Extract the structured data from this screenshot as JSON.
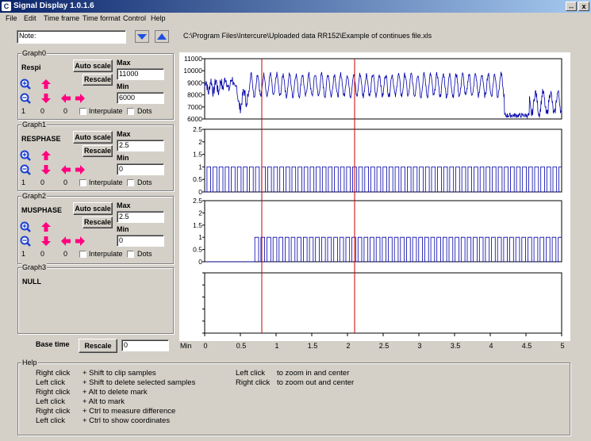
{
  "window": {
    "title": "Signal Display 1.0.1.6",
    "buttons": [
      "↔",
      "x"
    ]
  },
  "menu": [
    "File",
    "Edit",
    "Time frame",
    "Time format",
    "Control",
    "Help"
  ],
  "note": {
    "label": "Note:",
    "value": ""
  },
  "file_path": "C:\\Program Files\\Intercure\\Uploaded data RR152\\Example of continues file.xls",
  "graphs": [
    {
      "group": "Graph0",
      "signal": "Respi",
      "max": "11000",
      "min": "6000",
      "counters": [
        "1",
        "0",
        "0"
      ],
      "interpolate": "Interpulate",
      "dots": "Dots"
    },
    {
      "group": "Graph1",
      "signal": "RESPHASE",
      "max": "2.5",
      "min": "0",
      "counters": [
        "1",
        "0",
        "0"
      ],
      "interpolate": "Interpulate",
      "dots": "Dots"
    },
    {
      "group": "Graph2",
      "signal": "MUSPHASE",
      "max": "2.5",
      "min": "0",
      "counters": [
        "1",
        "0",
        "0"
      ],
      "interpolate": "Interpulate",
      "dots": "Dots"
    },
    {
      "group": "Graph3",
      "signal": "NULL"
    }
  ],
  "labels": {
    "auto_scale": "Auto scale",
    "rescale": "Rescale",
    "max": "Max",
    "min": "Min",
    "base_time": "Base time",
    "base_value": "0",
    "x_unit": "Min",
    "help_title": "Help"
  },
  "help_left": [
    [
      "Right click",
      "+ Shift to clip samples"
    ],
    [
      "Left click",
      "+ Shift to delete selected samples"
    ],
    [
      "Right click",
      "+ Alt to delete mark"
    ],
    [
      "Left click",
      "+ Alt to mark"
    ],
    [
      "Right click",
      "+ Ctrl to measure difference"
    ],
    [
      "Left click",
      "+ Ctrl to show coordinates"
    ]
  ],
  "help_right": [
    [
      "Left click",
      "to zoom in and center"
    ],
    [
      "Right click",
      "to zoom out and center"
    ]
  ],
  "chart_data": [
    {
      "type": "line",
      "series": [
        {
          "values_description": "respiration waveform oscillating 7500-10000"
        }
      ],
      "x_range": [
        0,
        5
      ],
      "ylim": [
        6000,
        11000
      ],
      "y_ticks": [
        "11000",
        "10000",
        "9000",
        "8000",
        "7000",
        "6000"
      ],
      "markers_x": [
        0.8,
        2.1
      ],
      "marker_color": "#cc0000",
      "line_color": "#0000aa"
    },
    {
      "type": "line",
      "ylim": [
        0,
        2.5
      ],
      "y_ticks": [
        "2.5",
        "2",
        "1.5",
        "1",
        "0.5",
        "0"
      ],
      "square_wave": {
        "low": 0,
        "high": 1
      },
      "x_range": [
        0,
        5
      ]
    },
    {
      "type": "line",
      "ylim": [
        0,
        2.5
      ],
      "y_ticks": [
        "2.5",
        "2",
        "1.5",
        "1",
        "0.5",
        "0"
      ],
      "square_wave": {
        "low": 0,
        "high": 1,
        "start": 0.67
      },
      "x_range": [
        0,
        5
      ]
    },
    {
      "type": "line",
      "ylim": null,
      "x_range": [
        0,
        5
      ]
    }
  ],
  "x_ticks": [
    "0",
    "0.5",
    "1",
    "1.5",
    "2",
    "2.5",
    "3",
    "3.5",
    "4",
    "4.5",
    "5"
  ],
  "colors": {
    "accent_pink": "#ff0080",
    "zoom_blue": "#1a3fd0",
    "scroll_blue": "#2050e0"
  }
}
